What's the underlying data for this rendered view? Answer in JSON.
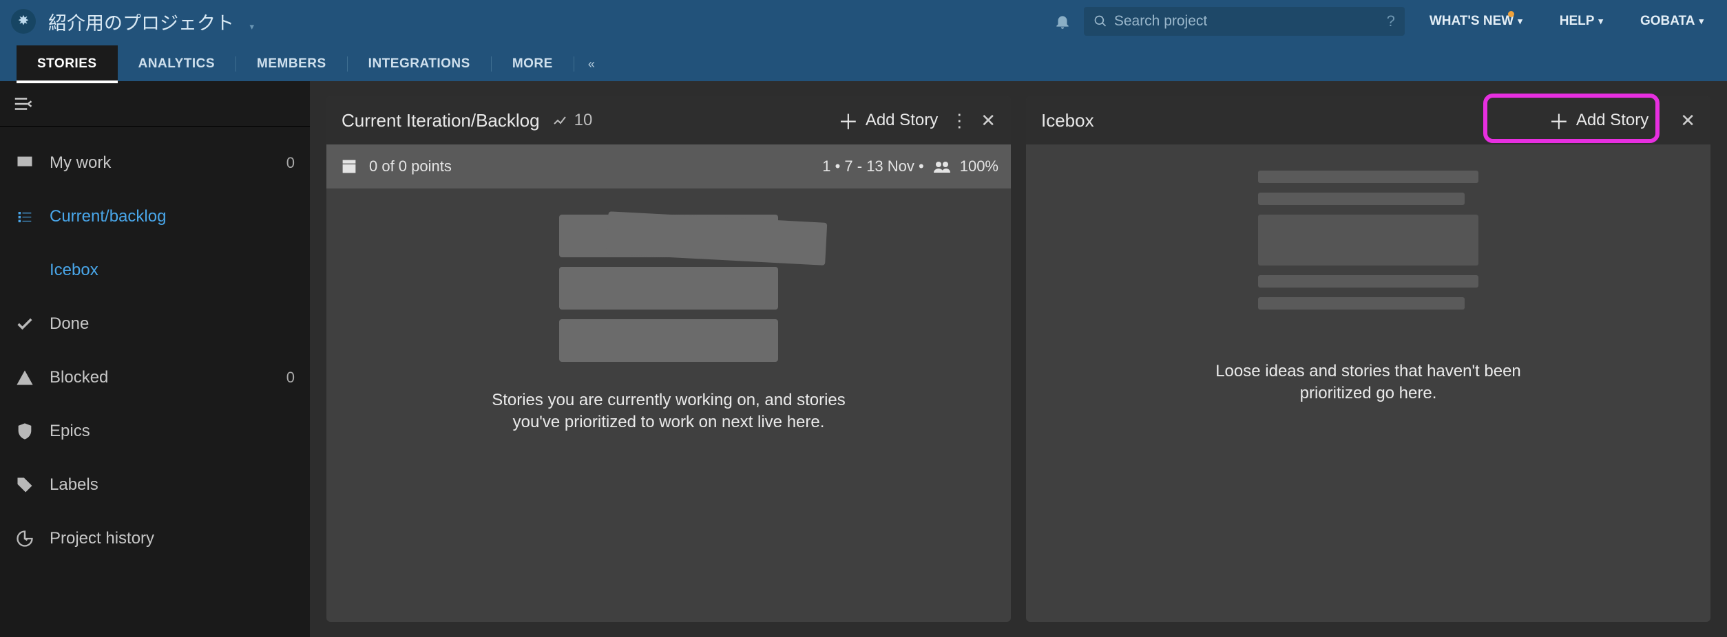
{
  "header": {
    "project_title": "紹介用のプロジェクト",
    "search_placeholder": "Search project",
    "search_hint": "?",
    "whats_new": "WHAT'S NEW",
    "help": "HELP",
    "user": "GOBATA"
  },
  "tabs": {
    "stories": "STORIES",
    "analytics": "ANALYTICS",
    "members": "MEMBERS",
    "integrations": "INTEGRATIONS",
    "more": "MORE"
  },
  "sidebar": {
    "my_work": {
      "label": "My work",
      "count": "0"
    },
    "current_backlog": {
      "label": "Current/backlog"
    },
    "icebox": {
      "label": "Icebox"
    },
    "done": {
      "label": "Done"
    },
    "blocked": {
      "label": "Blocked",
      "count": "0"
    },
    "epics": {
      "label": "Epics"
    },
    "labels": {
      "label": "Labels"
    },
    "history": {
      "label": "Project history"
    }
  },
  "panel_backlog": {
    "title": "Current Iteration/Backlog",
    "velocity": "10",
    "add_story": "Add Story",
    "iter_points": "0 of 0 points",
    "iter_range": "1 • 7 - 13 Nov •",
    "iter_percent": "100%",
    "empty_text": "Stories you are currently working on, and stories you've prioritized to work on next live here."
  },
  "panel_icebox": {
    "title": "Icebox",
    "add_story": "Add Story",
    "empty_text": "Loose ideas and stories that haven't been prioritized go here."
  }
}
